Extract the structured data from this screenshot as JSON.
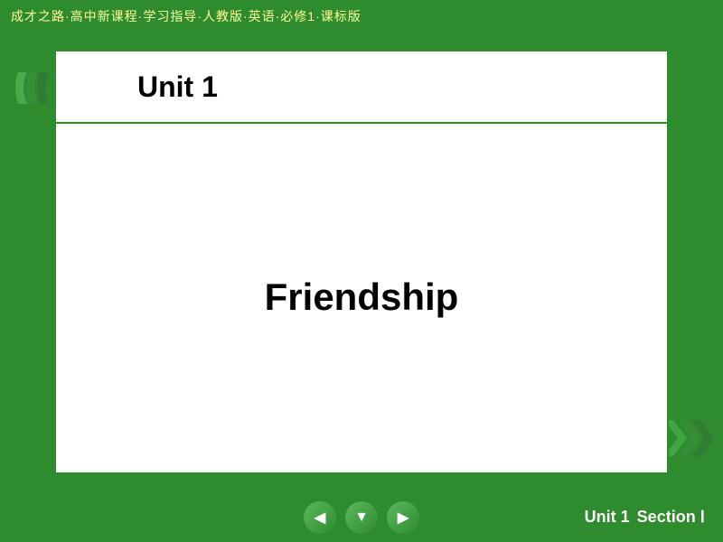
{
  "header": {
    "title": "成才之路·高中新课程·学习指导·人教版·英语·必修1·课标版"
  },
  "main": {
    "unit_label": "Unit 1",
    "topic": "Friendship"
  },
  "bottom": {
    "unit_text": "Unit 1",
    "section_text": "Section Ⅰ"
  },
  "nav": {
    "left_arrow": "◀",
    "home_arrow": "▼",
    "right_arrow": "▶"
  },
  "colors": {
    "green_dark": "#2e7d32",
    "green_medium": "#388e3c",
    "green_light": "#66bb6a",
    "white": "#ffffff",
    "black": "#000000"
  }
}
